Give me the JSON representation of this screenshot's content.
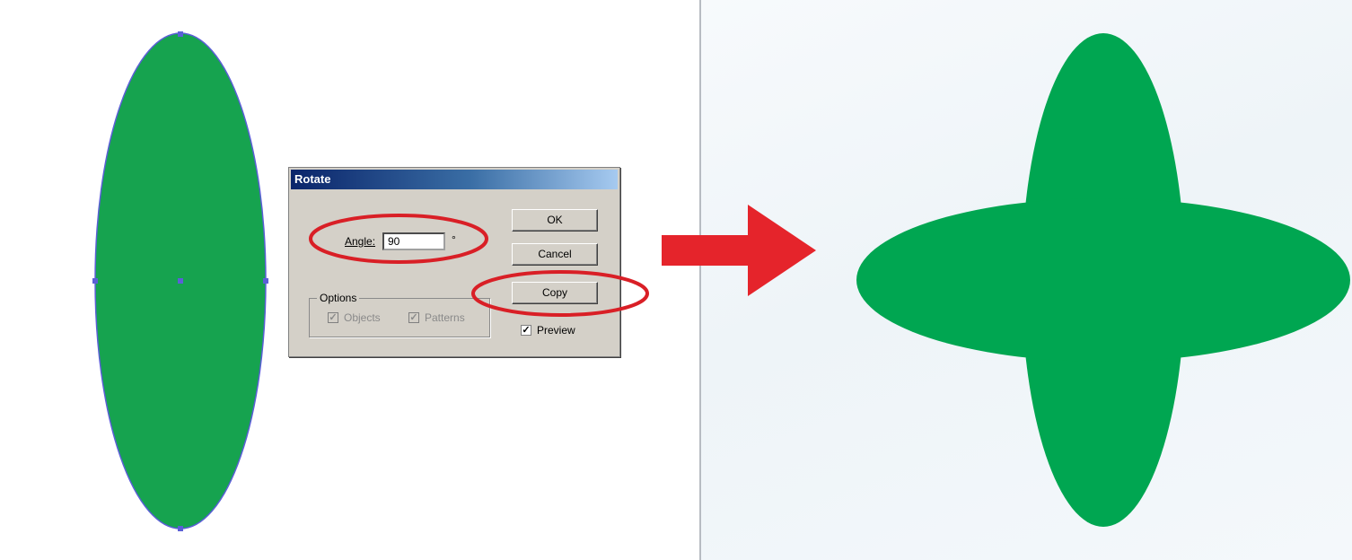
{
  "dialog": {
    "title": "Rotate",
    "angle_label": "Angle:",
    "angle_value": "90",
    "degree_symbol": "°",
    "ok_label": "OK",
    "cancel_label": "Cancel",
    "copy_label": "Copy",
    "options_label": "Options",
    "objects_label": "Objects",
    "objects_checked": true,
    "patterns_label": "Patterns",
    "patterns_checked": true,
    "preview_label": "Preview",
    "preview_checked": true
  },
  "colors": {
    "shape_fill": "#16a34f",
    "highlight": "#d91f26",
    "arrow": "#e5242b",
    "selection_path": "#5b5fd6"
  },
  "icons": {
    "arrow": "arrow-right-icon",
    "check": "checkmark-icon"
  }
}
